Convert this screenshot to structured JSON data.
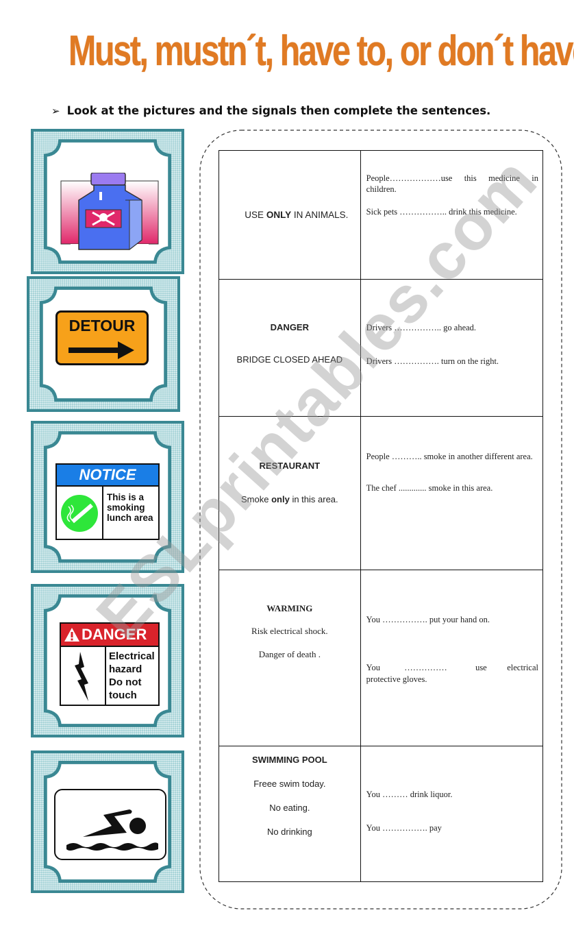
{
  "title": "Must, mustn´t, have to, or don´t have to.",
  "instruction": {
    "bullet": "➢",
    "text": "Look at the pictures and the signals then complete the sentences."
  },
  "pictures": [
    {
      "name": "poison-bottle",
      "alt": "Medicine bottle with skull and crossbones"
    },
    {
      "name": "detour-sign",
      "label": "DETOUR"
    },
    {
      "name": "notice-sign",
      "header": "NOTICE",
      "lines": [
        "This is a",
        "smoking",
        "lunch area"
      ]
    },
    {
      "name": "danger-sign",
      "header": "DANGER",
      "lines": [
        "Electrical",
        "hazard",
        "Do not",
        "touch"
      ]
    },
    {
      "name": "swimming-sign",
      "alt": "Swimmer pictogram"
    }
  ],
  "rows": [
    {
      "sign": {
        "pre": "USE ",
        "bold": "ONLY",
        "post": " IN ANIMALS."
      },
      "sentences": [
        "People………………use this medicine    in children.",
        "Sick pets  …………….. drink this medicine."
      ]
    },
    {
      "sign": {
        "heading": "DANGER",
        "lines": [
          "BRIDGE CLOSED AHEAD"
        ]
      },
      "sentences": [
        "Drivers ……………..  go ahead.",
        "Drivers ……………. turn on the right."
      ]
    },
    {
      "sign": {
        "heading": "RESTAURANT",
        "pre": "Smoke ",
        "bold": "only",
        "post": " in this area."
      },
      "sentences": [
        "People ………..  smoke in another different area.",
        "The chef ............. smoke in this area."
      ]
    },
    {
      "sign": {
        "heading": "WARMING",
        "lines": [
          "Risk electrical shock.",
          "Danger of death ."
        ]
      },
      "sentences": [
        "You ……………. put your hand on.",
        "You      ……………       use     electrical protective gloves."
      ]
    },
    {
      "sign": {
        "heading": "SWIMMING POOL",
        "lines": [
          "Freee swim today.",
          "No eating.",
          "No drinking"
        ]
      },
      "sentences": [
        "You  ………  drink liquor.",
        "You …………….  pay"
      ]
    }
  ],
  "watermark": "ESLprintables.com",
  "colors": {
    "title": "#e07a23",
    "frame": "#3a8893",
    "frame_fill": "#a8d4d8",
    "detour": "#f7a11a",
    "notice": "#1a7ee6",
    "danger": "#d9232b",
    "smoke_ok": "#2ee63a"
  }
}
